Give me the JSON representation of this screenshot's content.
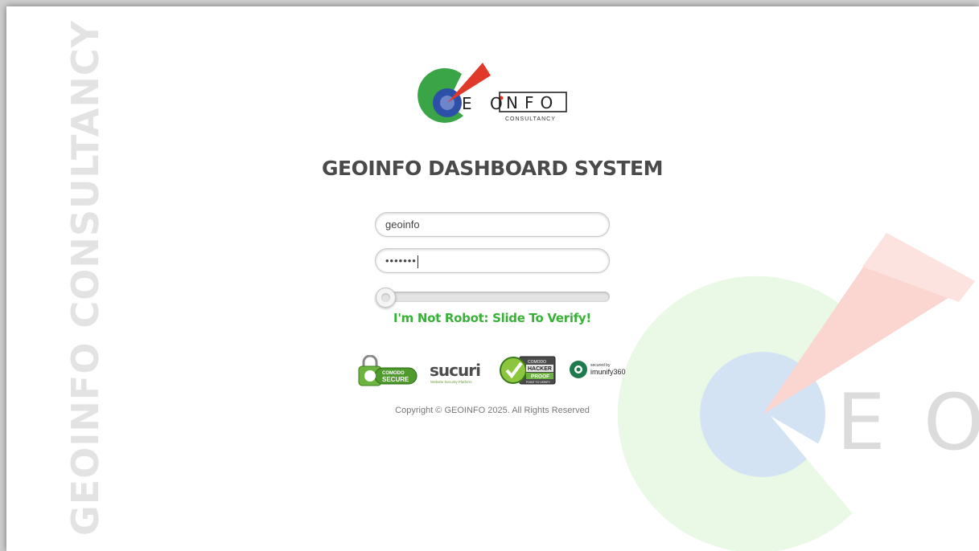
{
  "brand": {
    "logo_letters": "E O",
    "logo_word": "NFO",
    "logo_sub": "CONSULTANCY",
    "side_text": "GEOINFO CONSULTANCY",
    "bg_letters": [
      "E",
      "O"
    ]
  },
  "login": {
    "title": "GEOINFO DASHBOARD SYSTEM",
    "username_value": "geoinfo",
    "password_value": "•••••••",
    "verify_text": "I'm Not Robot: Slide To Verify!",
    "slider_progress": 0
  },
  "badges": {
    "comodo_top": "COMODO",
    "comodo_bottom": "SECURE",
    "sucuri": "sucuri",
    "sucuri_sub": "Website Security Platform",
    "hacker_top": "COMODO",
    "hacker_mid": "HACKER",
    "hacker_bot": "PROOF",
    "hacker_sub": "POINT TO VERIFY",
    "imunify_top": "secured by",
    "imunify_name": "imunify360"
  },
  "footer": {
    "copyright": "Copyright © GEOINFO 2025. All Rights Reserved"
  },
  "colors": {
    "green": "#3aa546",
    "blue": "#2d4fa8",
    "red": "#e0392a",
    "verify_green": "#38b236",
    "title_gray": "#4a4a4a"
  }
}
